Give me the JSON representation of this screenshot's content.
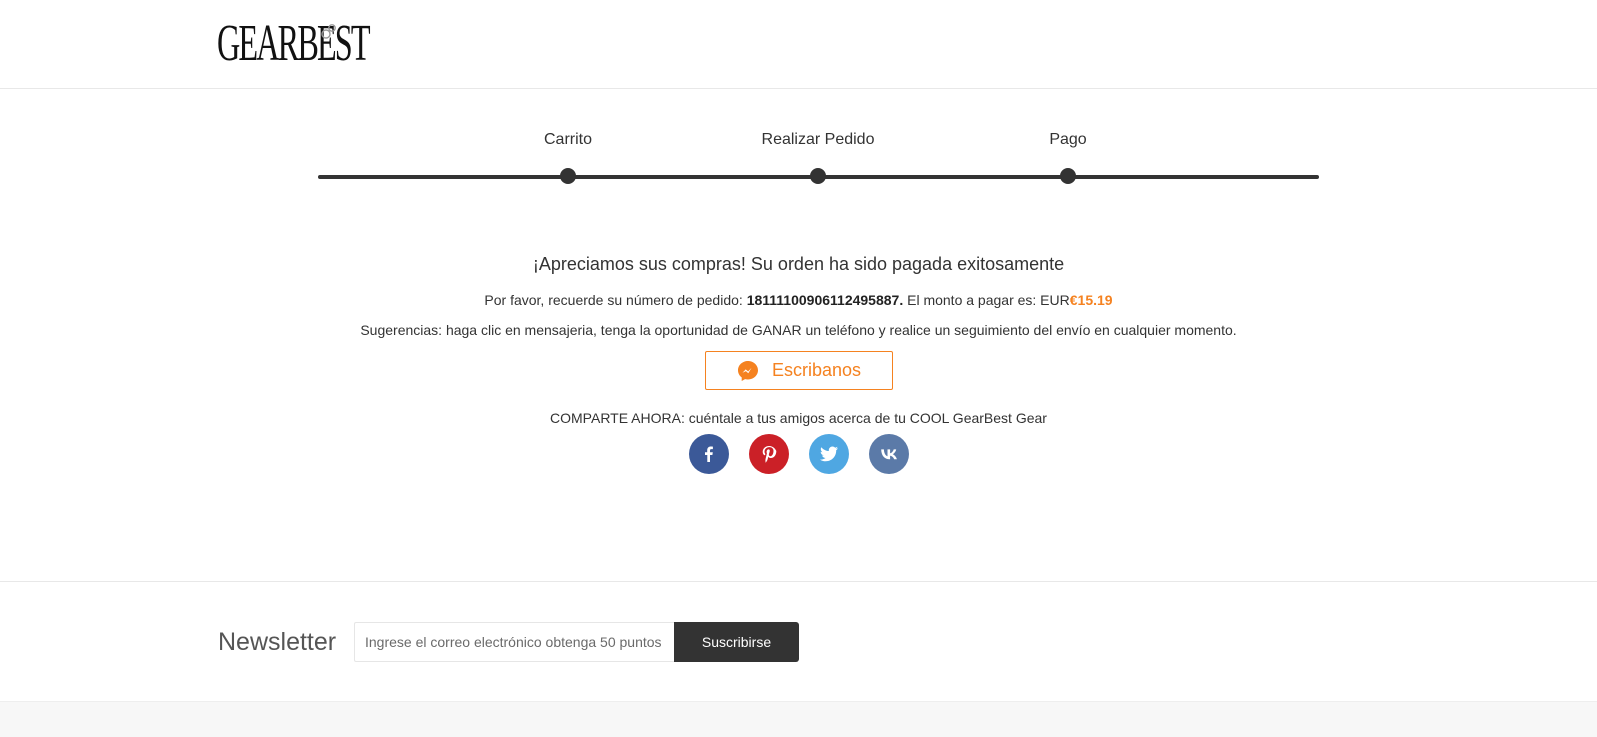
{
  "brand": {
    "logo_text": "GEARBEST"
  },
  "steps": [
    {
      "label": "Carrito"
    },
    {
      "label": "Realizar Pedido"
    },
    {
      "label": "Pago"
    }
  ],
  "confirmation": {
    "heading": "¡Apreciamos sus compras! Su orden ha sido pagada exitosamente",
    "order_prefix": "Por favor, recuerde su número de pedido:",
    "order_number": "18111100906112495887.",
    "amount_prefix": "El monto a pagar es: EUR",
    "amount": "€15.19",
    "tips": "Sugerencias: haga clic en mensajeria, tenga la oportunidad de GANAR un teléfono y realice un seguimiento del envío en cualquier momento.",
    "chat_button": "Escribanos",
    "share_text": "COMPARTE AHORA: cuéntale a tus amigos acerca de tu COOL GearBest Gear"
  },
  "socials": [
    {
      "name": "facebook-icon"
    },
    {
      "name": "pinterest-icon"
    },
    {
      "name": "twitter-icon"
    },
    {
      "name": "vk-icon"
    }
  ],
  "newsletter": {
    "title": "Newsletter",
    "placeholder": "Ingrese el correo electrónico obtenga 50 puntos",
    "button": "Suscribirse"
  },
  "colors": {
    "accent": "#f58220",
    "dark": "#333333",
    "facebook": "#3b5998",
    "pinterest": "#cb2027",
    "twitter": "#4fa7e2",
    "vk": "#5b7aa8"
  }
}
